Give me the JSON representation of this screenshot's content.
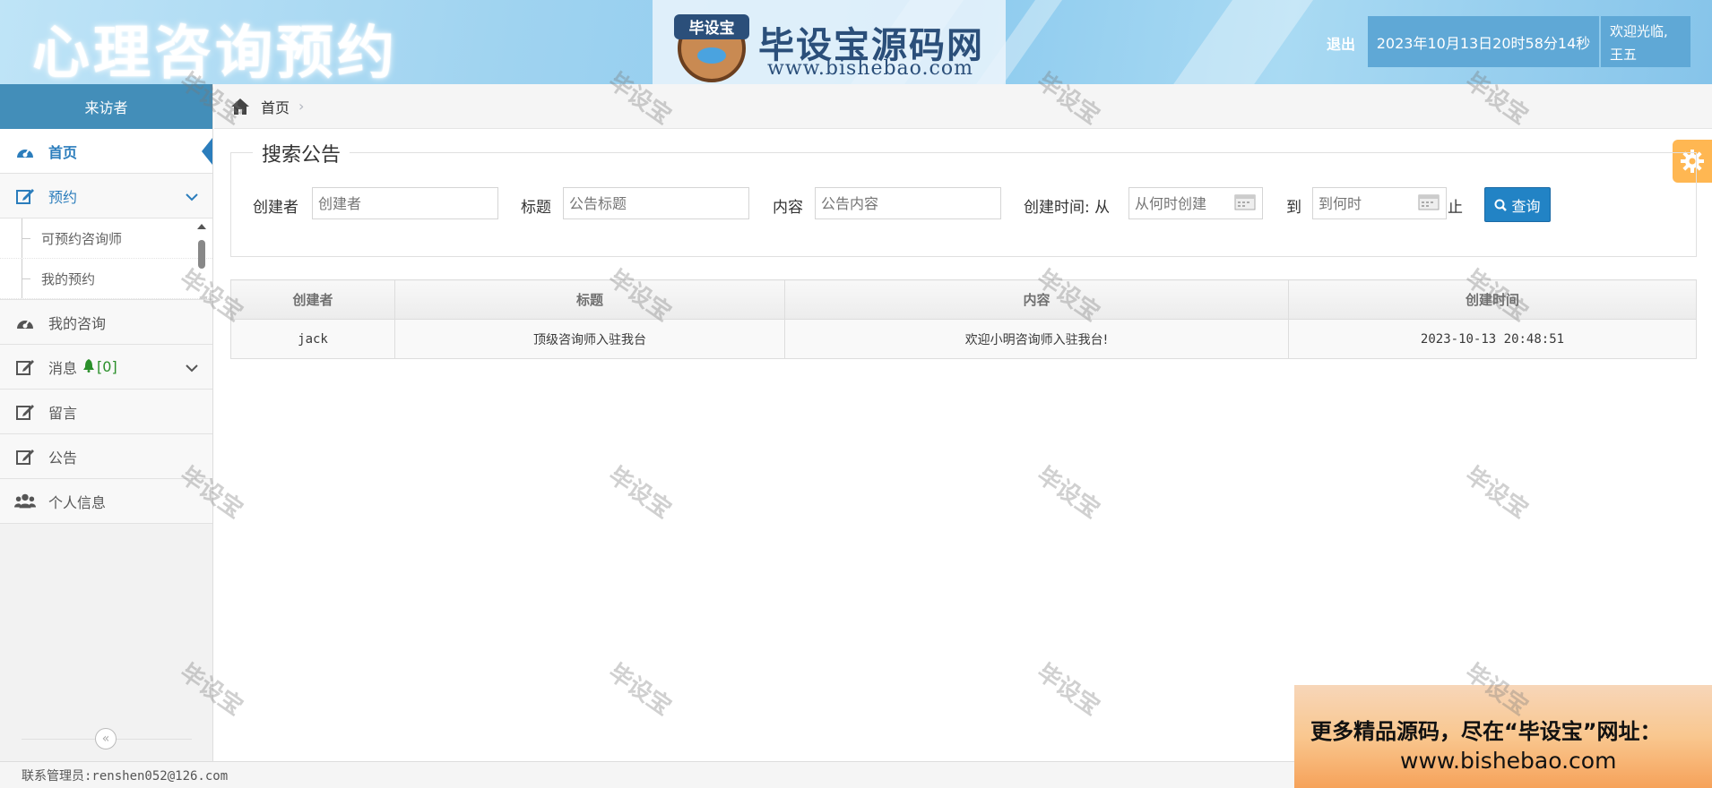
{
  "header": {
    "app_title": "心理咨询预约",
    "brand_badge": "毕设宝",
    "brand_name": "毕设宝源码网",
    "brand_url": "www.bishebao.com",
    "logout_label": "退出",
    "datetime": "2023年10月13日20时58分14秒",
    "welcome_line1": "欢迎光临,",
    "welcome_line2": "王五"
  },
  "sidebar": {
    "role": "来访者",
    "items": [
      {
        "label": "首页",
        "icon": "dashboard-icon",
        "active": true
      },
      {
        "label": "预约",
        "icon": "edit-icon",
        "expanded": true,
        "children": [
          {
            "label": "可预约咨询师"
          },
          {
            "label": "我的预约"
          }
        ]
      },
      {
        "label": "我的咨询",
        "icon": "dashboard-icon"
      },
      {
        "label": "消息",
        "icon": "edit-icon",
        "badge": "[0]"
      },
      {
        "label": "留言",
        "icon": "edit-icon"
      },
      {
        "label": "公告",
        "icon": "edit-icon"
      },
      {
        "label": "个人信息",
        "icon": "users-icon"
      }
    ],
    "collapse_symbol": "«"
  },
  "breadcrumb": {
    "home_label": "首页",
    "separator": "›"
  },
  "search": {
    "legend": "搜索公告",
    "creator_label": "创建者",
    "creator_placeholder": "创建者",
    "title_label": "标题",
    "title_placeholder": "公告标题",
    "content_label": "内容",
    "content_placeholder": "公告内容",
    "time_label": "创建时间: 从",
    "from_placeholder": "从何时创建",
    "to_label": "到",
    "to_placeholder": "到何时",
    "until_label": "止",
    "query_label": "查询"
  },
  "table": {
    "columns": [
      "创建者",
      "标题",
      "内容",
      "创建时间"
    ],
    "rows": [
      [
        "jack",
        "顶级咨询师入驻我台",
        "欢迎小明咨询师入驻我台!",
        "2023-10-13 20:48:51"
      ]
    ]
  },
  "footer": {
    "contact": "联系管理员:renshen052@126.com"
  },
  "promo": {
    "line1": "更多精品源码，尽在“毕设宝”网址：",
    "line2": "www.bishebao.com"
  },
  "watermark": "毕设宝",
  "colors": {
    "primary": "#438eb9",
    "button": "#2283c5",
    "settings": "#ffb752",
    "bell": "#2a8f2a"
  }
}
